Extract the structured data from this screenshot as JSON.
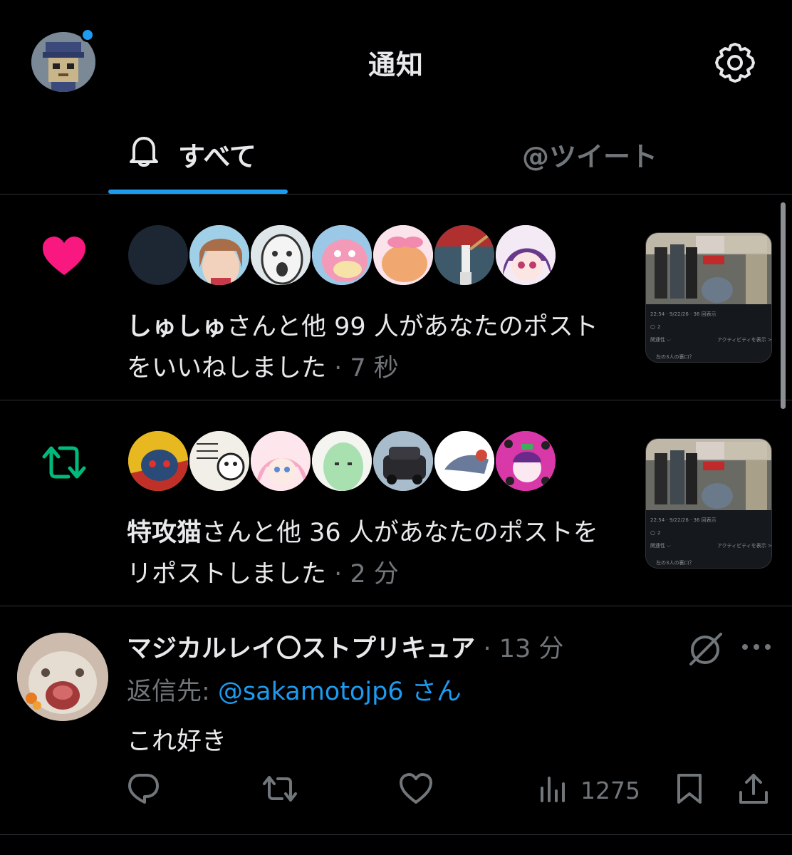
{
  "header": {
    "title": "通知"
  },
  "tabs": {
    "all_label": "すべて",
    "mentions_label": "@ツイート"
  },
  "notifications": [
    {
      "kind": "like",
      "icon": "heart-icon",
      "color": "#f91880",
      "actor": "しゅしゅ",
      "text": "さんと他 99 人があなたのポストをいいねしました",
      "time": "7 秒"
    },
    {
      "kind": "repost",
      "icon": "repost-icon",
      "color": "#00ba7c",
      "actor": "特攻猫",
      "text": "さんと他 36 人があなたのポストをリポストしました",
      "time": "2 分"
    }
  ],
  "post_thumbnail": {
    "meta": "22:54 · 9/22/26 · 36 回表示",
    "reply_count": "2",
    "activity_label": "アクティビティを表示 >",
    "relevance_label": "関連性 ⌵",
    "caption": "左の3人の裏口？"
  },
  "reply": {
    "name": "マジカルレイ〇ストプリキュア",
    "time": "13 分",
    "reply_to_label": "返信先: ",
    "handle": "@sakamotojp6",
    "handle_suffix": " さん",
    "body": "これ好き",
    "views": "1275"
  },
  "colors": {
    "accent": "#1d9bf0",
    "like": "#f91880",
    "repost": "#00ba7c",
    "muted": "#71767b",
    "text": "#e7e9ea"
  }
}
